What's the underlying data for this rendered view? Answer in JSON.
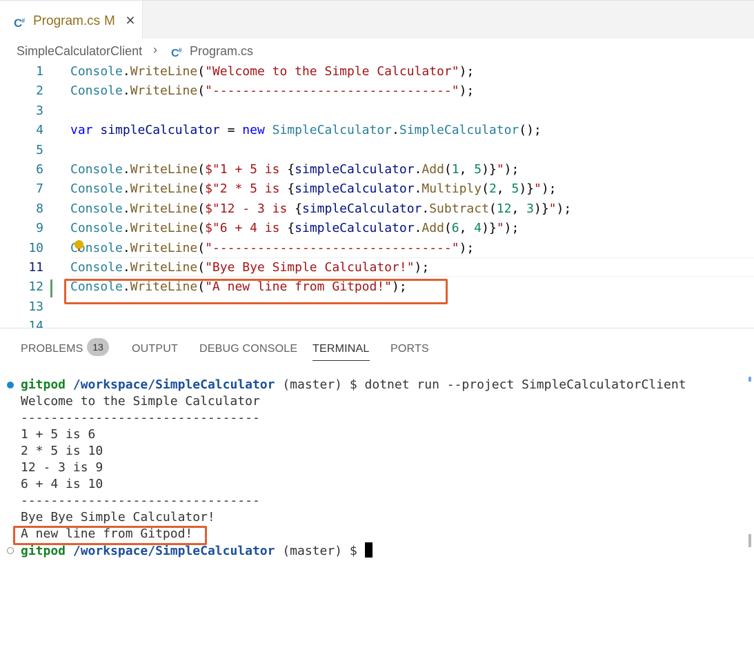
{
  "tab": {
    "icon": "csharp-icon",
    "filename": "Program.cs",
    "badge": "M",
    "close_glyph": "×"
  },
  "breadcrumb": {
    "folder": "SimpleCalculatorClient",
    "separator": "›",
    "file": "Program.cs"
  },
  "editor": {
    "lines": [
      {
        "n": "1",
        "tokens": [
          [
            "cls",
            "Console"
          ],
          [
            "p",
            "."
          ],
          [
            "fn",
            "WriteLine"
          ],
          [
            "p",
            "("
          ],
          [
            "str",
            "\"Welcome to the Simple Calculator\""
          ],
          [
            "p",
            ");"
          ]
        ]
      },
      {
        "n": "2",
        "tokens": [
          [
            "cls",
            "Console"
          ],
          [
            "p",
            "."
          ],
          [
            "fn",
            "WriteLine"
          ],
          [
            "p",
            "("
          ],
          [
            "str",
            "\"--------------------------------\""
          ],
          [
            "p",
            ");"
          ]
        ]
      },
      {
        "n": "3",
        "tokens": []
      },
      {
        "n": "4",
        "tokens": [
          [
            "kw",
            "var"
          ],
          [
            "p",
            " "
          ],
          [
            "var",
            "simpleCalculator"
          ],
          [
            "p",
            " = "
          ],
          [
            "kw",
            "new"
          ],
          [
            "p",
            " "
          ],
          [
            "cls",
            "SimpleCalculator"
          ],
          [
            "p",
            "."
          ],
          [
            "cls",
            "SimpleCalculator"
          ],
          [
            "p",
            "();"
          ]
        ]
      },
      {
        "n": "5",
        "tokens": []
      },
      {
        "n": "6",
        "tokens": [
          [
            "cls",
            "Console"
          ],
          [
            "p",
            "."
          ],
          [
            "fn",
            "WriteLine"
          ],
          [
            "p",
            "("
          ],
          [
            "str",
            "$\"1 + 5 is "
          ],
          [
            "p",
            "{"
          ],
          [
            "var",
            "simpleCalculator"
          ],
          [
            "p",
            "."
          ],
          [
            "fn",
            "Add"
          ],
          [
            "p",
            "("
          ],
          [
            "num",
            "1"
          ],
          [
            "p",
            ", "
          ],
          [
            "num",
            "5"
          ],
          [
            "p",
            ")}"
          ],
          [
            "str",
            "\""
          ],
          [
            "p",
            ");"
          ]
        ]
      },
      {
        "n": "7",
        "tokens": [
          [
            "cls",
            "Console"
          ],
          [
            "p",
            "."
          ],
          [
            "fn",
            "WriteLine"
          ],
          [
            "p",
            "("
          ],
          [
            "str",
            "$\"2 * 5 is "
          ],
          [
            "p",
            "{"
          ],
          [
            "var",
            "simpleCalculator"
          ],
          [
            "p",
            "."
          ],
          [
            "fn",
            "Multiply"
          ],
          [
            "p",
            "("
          ],
          [
            "num",
            "2"
          ],
          [
            "p",
            ", "
          ],
          [
            "num",
            "5"
          ],
          [
            "p",
            ")}"
          ],
          [
            "str",
            "\""
          ],
          [
            "p",
            ");"
          ]
        ]
      },
      {
        "n": "8",
        "tokens": [
          [
            "cls",
            "Console"
          ],
          [
            "p",
            "."
          ],
          [
            "fn",
            "WriteLine"
          ],
          [
            "p",
            "("
          ],
          [
            "str",
            "$\"12 - 3 is "
          ],
          [
            "p",
            "{"
          ],
          [
            "var",
            "simpleCalculator"
          ],
          [
            "p",
            "."
          ],
          [
            "fn",
            "Subtract"
          ],
          [
            "p",
            "("
          ],
          [
            "num",
            "12"
          ],
          [
            "p",
            ", "
          ],
          [
            "num",
            "3"
          ],
          [
            "p",
            ")}"
          ],
          [
            "str",
            "\""
          ],
          [
            "p",
            ");"
          ]
        ]
      },
      {
        "n": "9",
        "tokens": [
          [
            "cls",
            "Console"
          ],
          [
            "p",
            "."
          ],
          [
            "fn",
            "WriteLine"
          ],
          [
            "p",
            "("
          ],
          [
            "str",
            "$\"6 + 4 is "
          ],
          [
            "p",
            "{"
          ],
          [
            "var",
            "simpleCalculator"
          ],
          [
            "p",
            "."
          ],
          [
            "fn",
            "Add"
          ],
          [
            "p",
            "("
          ],
          [
            "num",
            "6"
          ],
          [
            "p",
            ", "
          ],
          [
            "num",
            "4"
          ],
          [
            "p",
            ")}"
          ],
          [
            "str",
            "\""
          ],
          [
            "p",
            ");"
          ]
        ]
      },
      {
        "n": "10",
        "tokens": [
          [
            "cls",
            "Console"
          ],
          [
            "p",
            "."
          ],
          [
            "fn",
            "WriteLine"
          ],
          [
            "p",
            "("
          ],
          [
            "str",
            "\"--------------------------------\""
          ],
          [
            "p",
            ");"
          ]
        ]
      },
      {
        "n": "11",
        "tokens": [
          [
            "cls",
            "Console"
          ],
          [
            "p",
            "."
          ],
          [
            "fn",
            "WriteLine"
          ],
          [
            "p",
            "("
          ],
          [
            "str",
            "\"Bye Bye Simple Calculator!\""
          ],
          [
            "p",
            ");"
          ]
        ]
      },
      {
        "n": "12",
        "tokens": [
          [
            "cls",
            "Console"
          ],
          [
            "p",
            "."
          ],
          [
            "fn",
            "WriteLine"
          ],
          [
            "p",
            "("
          ],
          [
            "str",
            "\"A new line from Gitpod!\""
          ],
          [
            "p",
            ");"
          ]
        ]
      },
      {
        "n": "13",
        "tokens": []
      },
      {
        "n": "14",
        "tokens": []
      }
    ],
    "active_line": "11"
  },
  "panel": {
    "tabs": [
      {
        "id": "problems",
        "label": "PROBLEMS"
      },
      {
        "id": "output",
        "label": "OUTPUT"
      },
      {
        "id": "debug",
        "label": "DEBUG CONSOLE"
      },
      {
        "id": "terminal",
        "label": "TERMINAL"
      },
      {
        "id": "ports",
        "label": "PORTS"
      }
    ],
    "problems_count": "13",
    "active_tab": "TERMINAL"
  },
  "terminal": {
    "prompt_user": "gitpod",
    "prompt_path": "/workspace/SimpleCalculator",
    "prompt_branch": "(master) $",
    "command": "dotnet run --project SimpleCalculatorClient",
    "output": [
      "Welcome to the Simple Calculator",
      "--------------------------------",
      "1 + 5 is 6",
      "2 * 5 is 10",
      "12 - 3 is 9",
      "6 + 4 is 10",
      "--------------------------------",
      "Bye Bye Simple Calculator!",
      "A new line from Gitpod!"
    ]
  },
  "colors": {
    "highlight_box": "#e06030",
    "class": "#267f99",
    "function": "#795e26",
    "string": "#a31515",
    "keyword": "#0000ff",
    "variable": "#001080",
    "number": "#098658",
    "prompt_user": "#148226",
    "prompt_path": "#1a4f9c"
  }
}
